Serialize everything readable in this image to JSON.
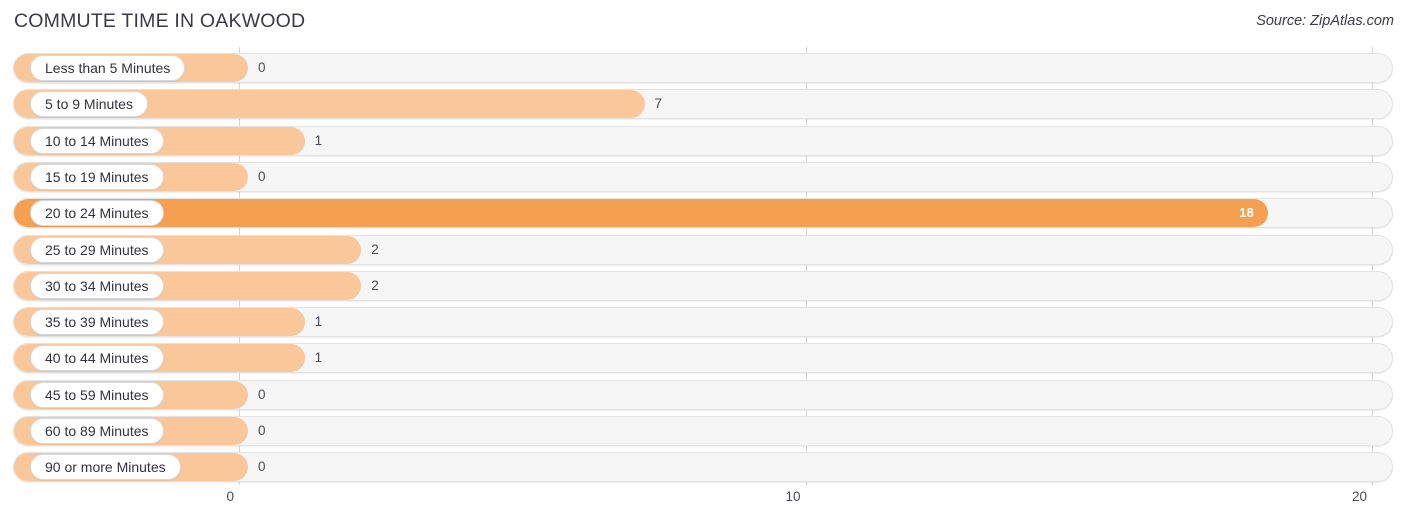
{
  "header": {
    "title": "COMMUTE TIME IN OAKWOOD",
    "source": "Source: ZipAtlas.com"
  },
  "colors": {
    "bar": "#fac79a",
    "bar_highlight": "#f5a051",
    "track": "#f6f6f6",
    "gridline": "#d6d6d6",
    "text": "#3b3b47"
  },
  "chart_data": {
    "type": "bar",
    "orientation": "horizontal",
    "title": "COMMUTE TIME IN OAKWOOD",
    "xlabel": "",
    "ylabel": "",
    "xlim": [
      0,
      20
    ],
    "grid": true,
    "legend": null,
    "axis_ticks": [
      "0",
      "10",
      "20"
    ],
    "axis_tick_values": [
      0,
      10,
      20
    ],
    "categories": [
      "Less than 5 Minutes",
      "5 to 9 Minutes",
      "10 to 14 Minutes",
      "15 to 19 Minutes",
      "20 to 24 Minutes",
      "25 to 29 Minutes",
      "30 to 34 Minutes",
      "35 to 39 Minutes",
      "40 to 44 Minutes",
      "45 to 59 Minutes",
      "60 to 89 Minutes",
      "90 or more Minutes"
    ],
    "values": [
      0,
      7,
      1,
      0,
      18,
      2,
      2,
      1,
      1,
      0,
      0,
      0
    ],
    "value_labels": [
      "0",
      "7",
      "1",
      "0",
      "18",
      "2",
      "2",
      "1",
      "1",
      "0",
      "0",
      "0"
    ],
    "highlight_index": 4
  }
}
